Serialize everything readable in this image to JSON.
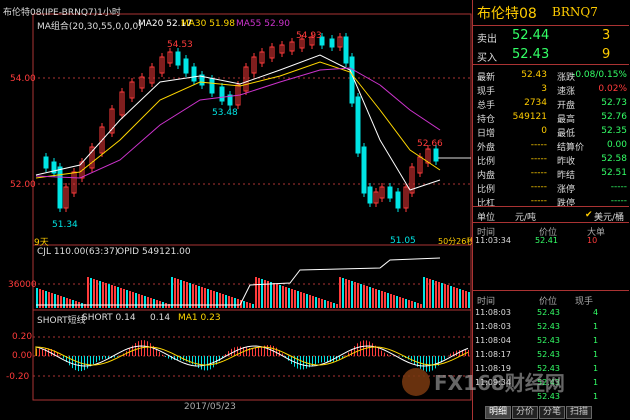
{
  "chart_window": {
    "title": "布伦特08(IPE-BRNQ7)1小时",
    "ma_legend": {
      "group": "MA组合(20,30,55,0,0,0)",
      "ma20": "MA20 52.17",
      "ma30": "MA30 51.98",
      "ma55": "MA55 52.90"
    },
    "price_labels": [
      "54.00",
      "52.00"
    ],
    "annotations": [
      "54.53",
      "54.93",
      "53.48",
      "52.66",
      "51.34",
      "51.05"
    ],
    "period_label": "9天",
    "tail_label": "50分26秒",
    "date_label": "2017/05/23",
    "volume_panel": {
      "header": "CJL 110.00(63:37)",
      "opid": "OPID 549121.00",
      "scale": "36000"
    },
    "short_panel": {
      "label": "SHORT短线",
      "short": "SHORT 0.14",
      "short_val": "0.14",
      "ma1": "MA1 0.23",
      "scale": [
        "0.20",
        "0.00",
        "-0.20"
      ]
    },
    "colors": {
      "up": "#ff3b3b",
      "down": "#00e5e5",
      "ma20": "#ffffff",
      "ma30": "#ffd700",
      "ma55": "#cc33cc",
      "accent": "#ffcc00"
    }
  },
  "quote": {
    "name": "布伦特08",
    "code": "BRNQ7",
    "sell": {
      "label": "卖出",
      "price": "52.44",
      "qty": "3"
    },
    "buy": {
      "label": "买入",
      "price": "52.43",
      "qty": "9"
    },
    "stats": [
      {
        "l1": "最新",
        "v1": "52.43",
        "l2": "涨跌",
        "v2": "-0.08/0.15%"
      },
      {
        "l1": "现手",
        "v1": "3",
        "l2": "速涨",
        "v2": "0.02%"
      },
      {
        "l1": "总手",
        "v1": "2734",
        "l2": "开盘",
        "v2": "52.73"
      },
      {
        "l1": "持仓",
        "v1": "549121",
        "l2": "最高",
        "v2": "52.76"
      },
      {
        "l1": "日增",
        "v1": "0",
        "l2": "最低",
        "v2": "52.35"
      },
      {
        "l1": "外盘",
        "v1": "-----",
        "l2": "结算价",
        "v2": "0.00"
      },
      {
        "l1": "比例",
        "v1": "-----",
        "l2": "昨收",
        "v2": "52.58"
      },
      {
        "l1": "内盘",
        "v1": "-----",
        "l2": "昨结",
        "v2": "52.51"
      },
      {
        "l1": "比例",
        "v1": "-----",
        "l2": "涨停",
        "v2": "-----"
      },
      {
        "l1": "比杠",
        "v1": "-----",
        "l2": "跌停",
        "v2": "-----"
      }
    ],
    "unit": {
      "label": "单位",
      "value": "元/吨",
      "currency": "美元/桶"
    },
    "big_trade": {
      "time": "11:03:34",
      "price": "52.41",
      "qty": "10"
    },
    "big_header": {
      "time": "时间",
      "price": "价位",
      "qty": "大单"
    },
    "ticks_header": {
      "time": "时间",
      "price": "价位",
      "qty": "现手"
    },
    "ticks": [
      {
        "time": "11:08:03",
        "price": "52.43",
        "qty": "4"
      },
      {
        "time": "11:08:03",
        "price": "52.43",
        "qty": "1"
      },
      {
        "time": "11:08:04",
        "price": "52.43",
        "qty": "1"
      },
      {
        "time": "11:08:17",
        "price": "52.43",
        "qty": "1"
      },
      {
        "time": "11:08:19",
        "price": "52.43",
        "qty": "1"
      },
      {
        "time": "11:09:34",
        "price": "52.43",
        "qty": "1"
      },
      {
        "time": "",
        "price": "52.43",
        "qty": "1"
      }
    ],
    "tabs": [
      "明细",
      "分价",
      "分笔",
      "扫描"
    ]
  },
  "watermark": {
    "text": "FX168财经网"
  }
}
